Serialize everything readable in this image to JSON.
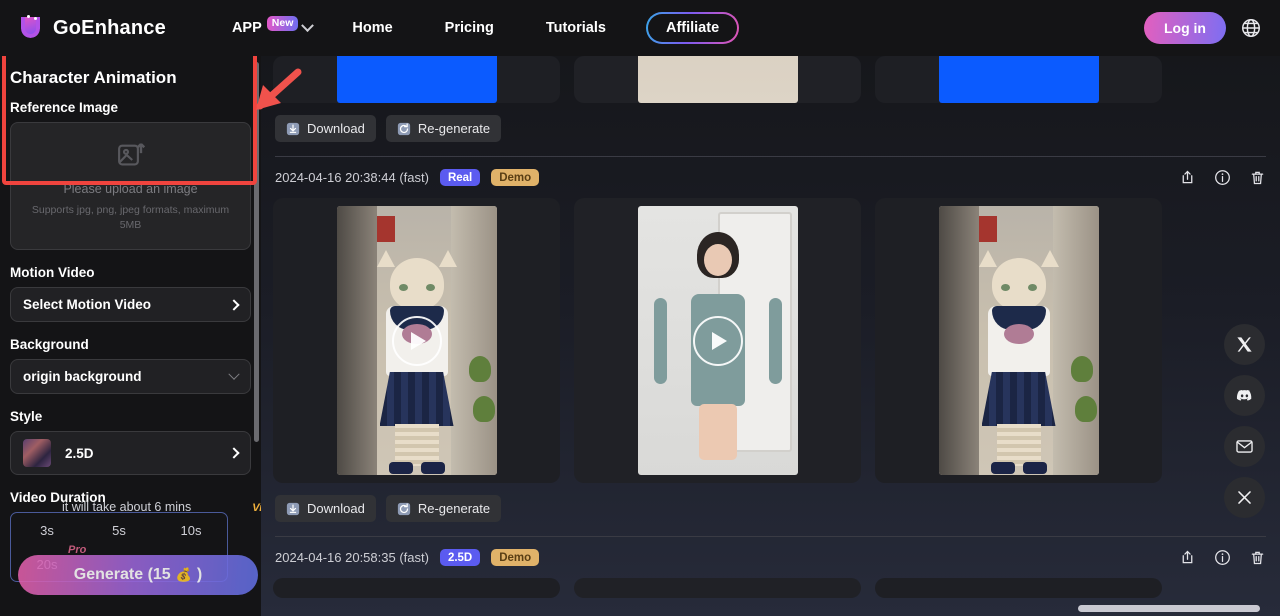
{
  "header": {
    "brand": "GoEnhance",
    "app_label": "APP",
    "app_badge": "New",
    "links": [
      "Home",
      "Pricing",
      "Tutorials"
    ],
    "affiliate": "Affiliate",
    "login": "Log in",
    "icons": {
      "chevron": "chevron-down-icon",
      "globe": "globe-icon"
    },
    "colors": {
      "accent_start": "#e35fbe",
      "accent_end": "#7d6ef2"
    }
  },
  "sidebar": {
    "title": "Character Animation",
    "reference_image": {
      "label": "Reference Image",
      "upload_primary": "Please upload an image",
      "upload_secondary": "Supports jpg, png, jpeg formats, maximum 5MB",
      "icon": "image-upload-icon",
      "highlight_color": "#f0443e"
    },
    "motion_video": {
      "label": "Motion Video",
      "value": "Select Motion Video"
    },
    "background": {
      "label": "Background",
      "value": "origin background"
    },
    "style": {
      "label": "Style",
      "value": "2.5D"
    },
    "duration": {
      "label": "Video Duration",
      "note": "it will take about 6 mins",
      "vip": "Vip",
      "pro": "Pro",
      "options": [
        "3s",
        "5s",
        "10s",
        "20s"
      ],
      "selected": "3s"
    },
    "generate": {
      "label": "Generate (15",
      "suffix": ")",
      "coin": "coin-icon"
    }
  },
  "main": {
    "rows": [
      {
        "timestamp": "",
        "tags": [],
        "buttons": {
          "download": "Download",
          "regenerate": "Re-generate"
        },
        "cards": [
          "legs-blue",
          "road",
          "legs-blue"
        ]
      },
      {
        "timestamp": "2024-04-16 20:38:44 (fast)",
        "tags": [
          {
            "label": "Real",
            "kind": "real"
          },
          {
            "label": "Demo",
            "kind": "demo"
          }
        ],
        "buttons": {
          "download": "Download",
          "regenerate": "Re-generate"
        },
        "cards": [
          "cat-alley",
          "woman-room",
          "cat-alley-static"
        ]
      },
      {
        "timestamp": "2024-04-16 20:58:35 (fast)",
        "tags": [
          {
            "label": "2.5D",
            "kind": "d25"
          },
          {
            "label": "Demo",
            "kind": "demo"
          }
        ],
        "buttons": {},
        "cards": []
      }
    ],
    "row_icons": [
      "share-icon",
      "info-icon",
      "trash-icon"
    ]
  },
  "rail": {
    "items": [
      {
        "name": "x-twitter-icon"
      },
      {
        "name": "discord-icon"
      },
      {
        "name": "email-icon"
      },
      {
        "name": "close-icon"
      }
    ]
  }
}
